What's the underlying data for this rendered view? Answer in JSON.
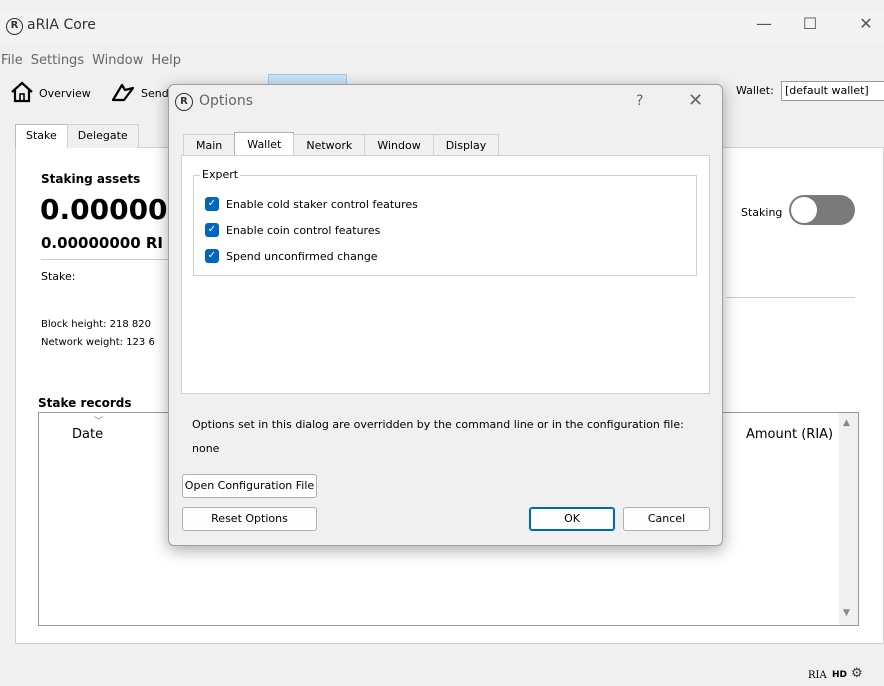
{
  "window": {
    "title": "aRIA Core",
    "logo_glyph": "R",
    "controls": {
      "minimize": "—",
      "maximize": "☐",
      "close": "✕"
    }
  },
  "menu": [
    "File",
    "Settings",
    "Window",
    "Help"
  ],
  "toolbar": {
    "overview_label": "Overview",
    "send_label": "Send",
    "wallet_label": "Wallet:",
    "wallet_value": "[default wallet]"
  },
  "main_tabs": [
    "Stake",
    "Delegate"
  ],
  "stake": {
    "assets_title": "Staking assets",
    "big_balance": "0.000000",
    "mid_balance": "0.00000000 RI",
    "stake_label": "Stake:",
    "block_height": "Block height: 218 820",
    "network_weight": "Network weight: 123 6",
    "staking_label": "Staking",
    "records_title": "Stake records",
    "columns": {
      "date": "Date",
      "amount": "Amount (RIA)"
    }
  },
  "statusbar": {
    "unit": "RIA",
    "hd": "HD"
  },
  "dialog": {
    "title": "Options",
    "help": "?",
    "close": "✕",
    "tabs": [
      "Main",
      "Wallet",
      "Network",
      "Window",
      "Display"
    ],
    "active_tab": "Wallet",
    "group_title": "Expert",
    "checkboxes": [
      {
        "label": "Enable cold staker control features",
        "checked": true
      },
      {
        "label": "Enable coin control features",
        "checked": true
      },
      {
        "label": "Spend unconfirmed change",
        "checked": true
      }
    ],
    "note": "Options set in this dialog are overridden by the command line or in the configuration file:",
    "note_value": "none",
    "buttons": {
      "open_config": "Open Configuration File",
      "reset": "Reset Options",
      "ok": "OK",
      "cancel": "Cancel"
    }
  },
  "colors": {
    "accent": "#0067c0",
    "toggle_off": "#7a7a7a"
  }
}
